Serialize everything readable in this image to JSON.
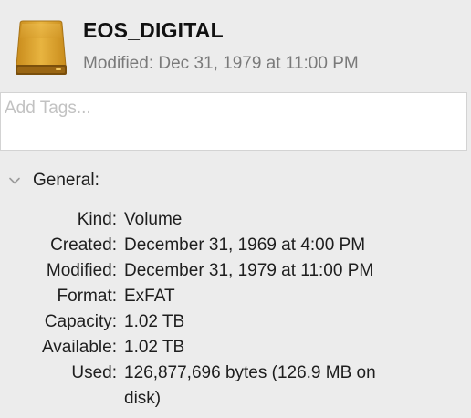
{
  "header": {
    "title": "EOS_DIGITAL",
    "modified": "Modified: Dec 31, 1979 at 11:00 PM",
    "icon": "external-drive-icon"
  },
  "tags": {
    "placeholder": "Add Tags...",
    "value": ""
  },
  "general": {
    "label": "General:",
    "expanded": true,
    "rows": [
      {
        "label": "Kind:",
        "value": "Volume"
      },
      {
        "label": "Created:",
        "value": "December 31, 1969 at 4:00 PM"
      },
      {
        "label": "Modified:",
        "value": "December 31, 1979 at 11:00 PM"
      },
      {
        "label": "Format:",
        "value": "ExFAT"
      },
      {
        "label": "Capacity:",
        "value": "1.02 TB"
      },
      {
        "label": "Available:",
        "value": "1.02 TB"
      },
      {
        "label": "Used:",
        "value": "126,877,696 bytes (126.9 MB on disk)"
      }
    ]
  },
  "colors": {
    "background": "#ececec",
    "drive_body": "#d9a128",
    "drive_front": "#8a5c10",
    "subtitle": "#7a7a7a"
  }
}
